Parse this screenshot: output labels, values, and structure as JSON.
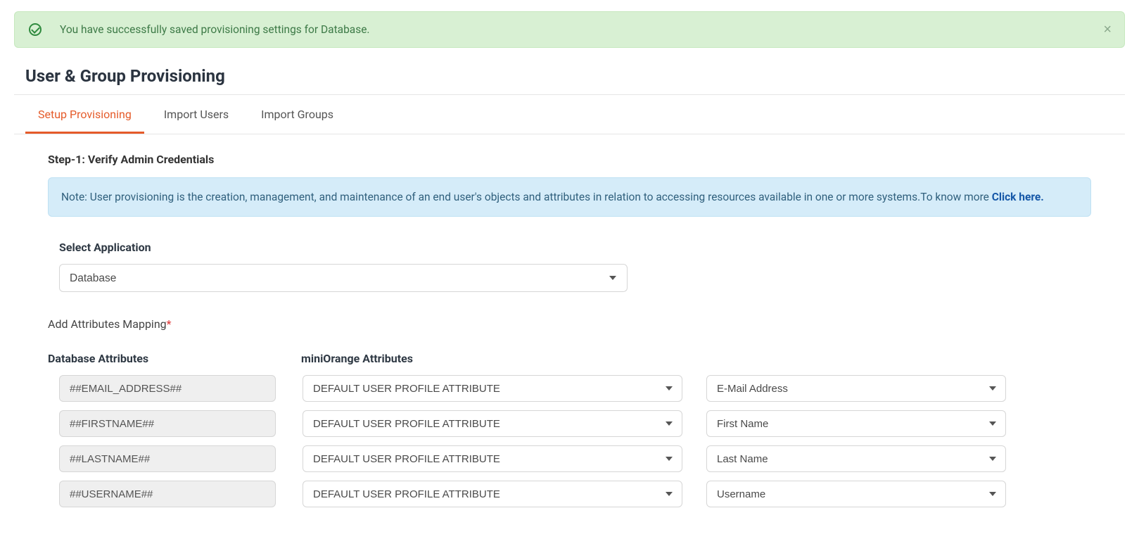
{
  "alert": {
    "message": "You have successfully saved provisioning settings for Database."
  },
  "page_title": "User & Group Provisioning",
  "tabs": [
    {
      "label": "Setup Provisioning",
      "active": true
    },
    {
      "label": "Import Users",
      "active": false
    },
    {
      "label": "Import Groups",
      "active": false
    }
  ],
  "step1": {
    "step_label": "Step-1:",
    "step_text": "Verify Admin Credentials"
  },
  "info": {
    "note_text": "Note: User provisioning is the creation, management, and maintenance of an end user's objects and attributes in relation to accessing resources available in one or more systems.To know more ",
    "link_text": "Click here."
  },
  "select_app": {
    "label": "Select Application",
    "value": "Database"
  },
  "attrs_mapping_label": "Add Attributes Mapping",
  "columns": {
    "db": "Database Attributes",
    "mo": "miniOrange Attributes"
  },
  "rows": [
    {
      "db": "##EMAIL_ADDRESS##",
      "mo_type": "DEFAULT USER PROFILE ATTRIBUTE",
      "mo_field": "E-Mail Address"
    },
    {
      "db": "##FIRSTNAME##",
      "mo_type": "DEFAULT USER PROFILE ATTRIBUTE",
      "mo_field": "First Name"
    },
    {
      "db": "##LASTNAME##",
      "mo_type": "DEFAULT USER PROFILE ATTRIBUTE",
      "mo_field": "Last Name"
    },
    {
      "db": "##USERNAME##",
      "mo_type": "DEFAULT USER PROFILE ATTRIBUTE",
      "mo_field": "Username"
    }
  ]
}
